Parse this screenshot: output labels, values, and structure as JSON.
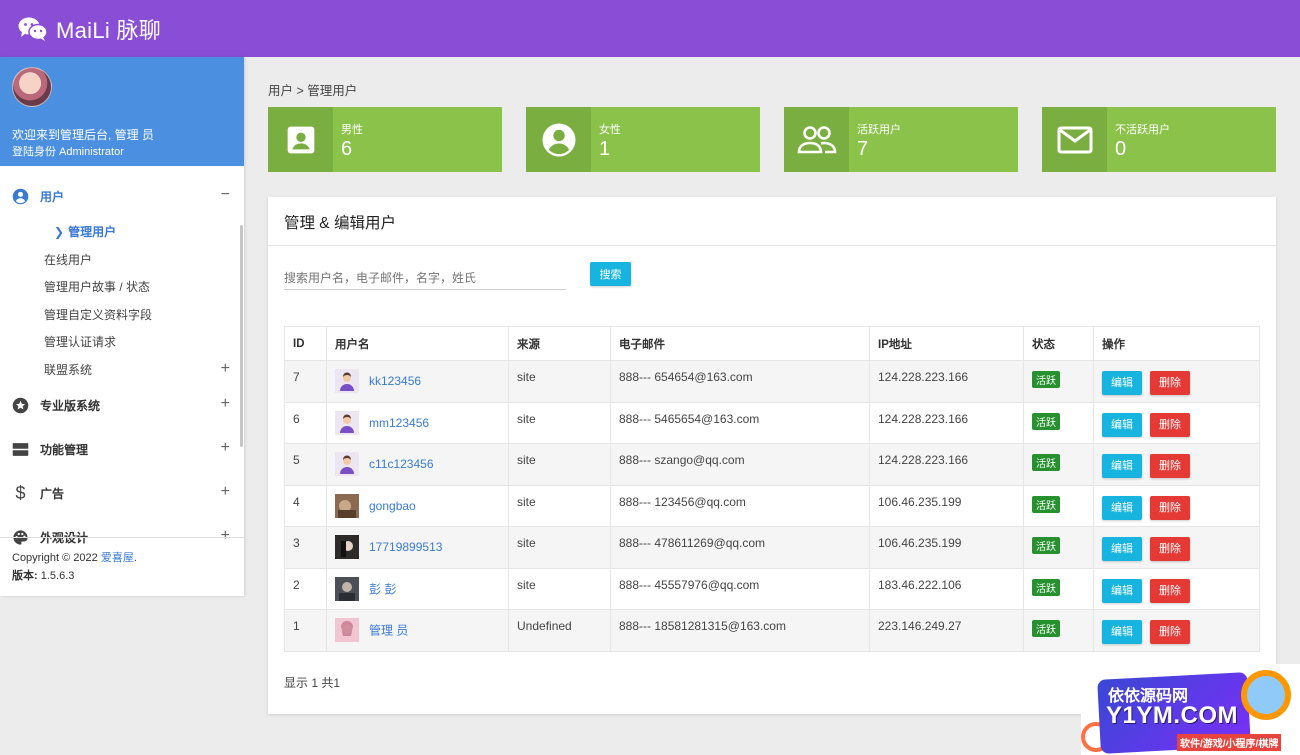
{
  "app": {
    "brand": "MaiLi 脉聊"
  },
  "profile": {
    "welcome": "欢迎来到管理后台, 管理 员",
    "role": "登陆身份 Administrator"
  },
  "nav": {
    "users": {
      "label": "用户",
      "sign": "−"
    },
    "users_sub": [
      {
        "label": "管理用户",
        "current": true
      },
      {
        "label": "在线用户"
      },
      {
        "label": "管理用户故事 / 状态"
      },
      {
        "label": "管理自定义资料字段"
      },
      {
        "label": "管理认证请求"
      },
      {
        "label": "联盟系统",
        "sign": "+"
      }
    ],
    "pro": {
      "label": "专业版系统",
      "sign": "+"
    },
    "features": {
      "label": "功能管理",
      "sign": "+"
    },
    "ads": {
      "label": "广告",
      "sign": "+"
    },
    "design": {
      "label": "外观设计",
      "sign": "+"
    }
  },
  "footer": {
    "copyright_prefix": "Copyright © 2022",
    "copyright_link": "爱喜屋",
    "copyright_suffix": ".",
    "version_label": "版本:",
    "version_value": "1.5.6.3"
  },
  "breadcrumb": "用户 > 管理用户",
  "stats": [
    {
      "label": "男性",
      "value": "6",
      "icon": "contact-card-icon"
    },
    {
      "label": "女性",
      "value": "1",
      "icon": "account-circle-icon"
    },
    {
      "label": "活跃用户",
      "value": "7",
      "icon": "group-icon"
    },
    {
      "label": "不活跃用户",
      "value": "0",
      "icon": "mail-icon"
    }
  ],
  "panel": {
    "title": "管理 & 编辑用户",
    "search_placeholder": "搜索用户名，电子邮件，名字，姓氏",
    "search_button": "搜索",
    "columns": [
      "ID",
      "用户名",
      "来源",
      "电子邮件",
      "IP地址",
      "状态",
      "操作"
    ],
    "rows": [
      {
        "id": "7",
        "username": "kk123456",
        "source": "site",
        "email": "888--- 654654@163.com",
        "ip": "124.228.223.166",
        "status": "活跃",
        "avatar": "default"
      },
      {
        "id": "6",
        "username": "mm123456",
        "source": "site",
        "email": "888--- 5465654@163.com",
        "ip": "124.228.223.166",
        "status": "活跃",
        "avatar": "default"
      },
      {
        "id": "5",
        "username": "c11c123456",
        "source": "site",
        "email": "888--- szango@qq.com",
        "ip": "124.228.223.166",
        "status": "活跃",
        "avatar": "default"
      },
      {
        "id": "4",
        "username": "gongbao",
        "source": "site",
        "email": "888--- 123456@qq.com",
        "ip": "106.46.235.199",
        "status": "活跃",
        "avatar": "photo-brown"
      },
      {
        "id": "3",
        "username": "17719899513",
        "source": "site",
        "email": "888--- 478611269@qq.com",
        "ip": "106.46.235.199",
        "status": "活跃",
        "avatar": "photo-dark"
      },
      {
        "id": "2",
        "username": "彭 彭",
        "source": "site",
        "email": "888--- 45557976@qq.com",
        "ip": "183.46.222.106",
        "status": "活跃",
        "avatar": "photo-gray"
      },
      {
        "id": "1",
        "username": "管理 员",
        "source": "Undefined",
        "email": "888--- 18581281315@163.com",
        "ip": "223.146.249.27",
        "status": "活跃",
        "avatar": "photo-pink"
      }
    ],
    "edit_label": "编辑",
    "delete_label": "删除",
    "pager": "显示 1 共1"
  },
  "watermark": {
    "line1": "依依源码网",
    "line2": "Y1YM.COM",
    "line3": "软件/游戏/小程序/棋牌"
  },
  "colors": {
    "topbar": "#8a4ed6",
    "profile": "#4a8fe0",
    "stat": "#8bc34a",
    "accent": "#17b4e0",
    "danger": "#e53935",
    "active": "#27912f"
  }
}
